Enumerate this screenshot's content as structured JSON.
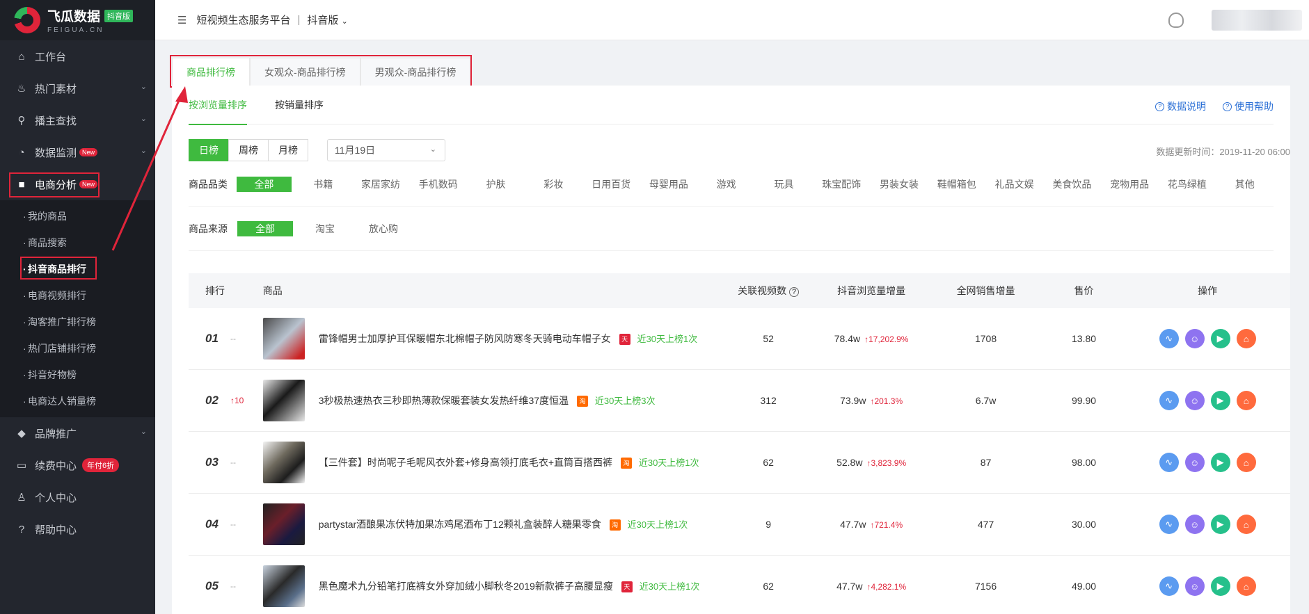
{
  "logo": {
    "title": "飞瓜数据",
    "badge": "抖音版",
    "subtitle": "FEIGUA.CN"
  },
  "header": {
    "platform": "短视频生态服务平台",
    "separator": "|",
    "version": "抖音版"
  },
  "sidebar": {
    "items": [
      {
        "label": "工作台",
        "icon": "home-icon"
      },
      {
        "label": "热门素材",
        "icon": "fire-icon"
      },
      {
        "label": "播主查找",
        "icon": "search-icon"
      },
      {
        "label": "数据监测",
        "icon": "monitor-icon",
        "badge": "New"
      },
      {
        "label": "电商分析",
        "icon": "bag-icon",
        "badge": "New"
      }
    ],
    "sub_items": [
      "我的商品",
      "商品搜索",
      "抖音商品排行",
      "电商视频排行",
      "淘客推广排行榜",
      "热门店铺排行榜",
      "抖音好物榜",
      "电商达人销量榜"
    ],
    "items_after": [
      {
        "label": "品牌推广",
        "icon": "diamond-icon"
      },
      {
        "label": "续费中心",
        "icon": "card-icon",
        "badge": "年付6折"
      },
      {
        "label": "个人中心",
        "icon": "user-icon"
      },
      {
        "label": "帮助中心",
        "icon": "help-icon"
      }
    ]
  },
  "top_tabs": [
    "商品排行榜",
    "女观众-商品排行榜",
    "男观众-商品排行榜"
  ],
  "sub_tabs": [
    "按浏览量排序",
    "按销量排序"
  ],
  "help_links": [
    "数据说明",
    "使用帮助"
  ],
  "periods": [
    "日榜",
    "周榜",
    "月榜"
  ],
  "date_value": "11月19日",
  "update_time": "数据更新时间：2019-11-20 06:00",
  "category": {
    "label": "商品品类",
    "options": [
      "全部",
      "书籍",
      "家居家纺",
      "手机数码",
      "护肤",
      "彩妆",
      "日用百货",
      "母婴用品",
      "游戏",
      "玩具",
      "珠宝配饰",
      "男装女装",
      "鞋帽箱包",
      "礼品文娱",
      "美食饮品",
      "宠物用品",
      "花鸟绿植",
      "其他"
    ]
  },
  "source": {
    "label": "商品来源",
    "options": [
      "全部",
      "淘宝",
      "放心购"
    ]
  },
  "table": {
    "headers": {
      "rank": "排行",
      "product": "商品",
      "videos": "关联视频数",
      "views": "抖音浏览量增量",
      "sales": "全网销售增量",
      "price": "售价",
      "ops": "操作"
    },
    "rows": [
      {
        "rank": "01",
        "change": "--",
        "name": "雷锋帽男士加厚护耳保暖帽东北棉帽子防风防寒冬天骑电动车帽子女",
        "shop": "天猫",
        "listed": "近30天上榜1次",
        "videos": "52",
        "views": "78.4w",
        "view_inc": "↑17,202.9%",
        "sales": "1708",
        "price": "13.80"
      },
      {
        "rank": "02",
        "change": "↑10",
        "name": "3秒极热速热衣三秒即热薄款保暖套装女发热纤维37度恒温",
        "shop": "淘",
        "listed": "近30天上榜3次",
        "videos": "312",
        "views": "73.9w",
        "view_inc": "↑201.3%",
        "sales": "6.7w",
        "price": "99.90"
      },
      {
        "rank": "03",
        "change": "--",
        "name": "【三件套】时尚呢子毛呢风衣外套+修身高领打底毛衣+直筒百搭西裤",
        "shop": "淘",
        "listed": "近30天上榜1次",
        "videos": "62",
        "views": "52.8w",
        "view_inc": "↑3,823.9%",
        "sales": "87",
        "price": "98.00"
      },
      {
        "rank": "04",
        "change": "--",
        "name": "partystar酒酿果冻伏特加果冻鸡尾酒布丁12颗礼盒装醉人糖果零食",
        "shop": "淘",
        "listed": "近30天上榜1次",
        "videos": "9",
        "views": "47.7w",
        "view_inc": "↑721.4%",
        "sales": "477",
        "price": "30.00"
      },
      {
        "rank": "05",
        "change": "--",
        "name": "黑色魔术九分铅笔打底裤女外穿加绒小脚秋冬2019新款裤子高腰显瘦",
        "shop": "天猫",
        "listed": "近30天上榜1次",
        "videos": "62",
        "views": "47.7w",
        "view_inc": "↑4,282.1%",
        "sales": "7156",
        "price": "49.00"
      }
    ]
  },
  "colors": {
    "accent": "#3fba3f",
    "highlight": "#e0243a",
    "sidebar_bg": "#23262e",
    "link": "#2a6fd6"
  }
}
